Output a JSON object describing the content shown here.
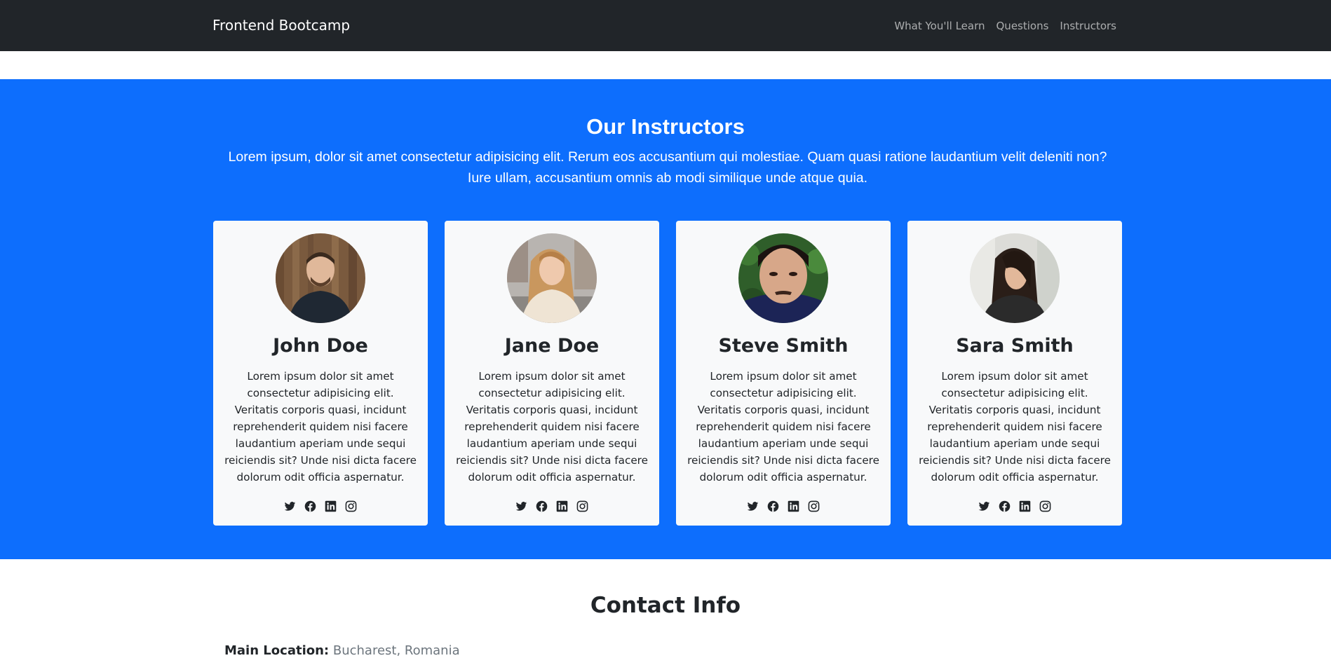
{
  "navbar": {
    "brand": "Frontend Bootcamp",
    "links": [
      "What You'll Learn",
      "Questions",
      "Instructors"
    ]
  },
  "instructors": {
    "title": "Our Instructors",
    "lead": "Lorem ipsum, dolor sit amet consectetur adipisicing elit. Rerum eos accusantium qui molestiae. Quam quasi ratione laudantium velit deleniti non? Iure ullam, accusantium omnis ab modi similique unde atque quia.",
    "cards": [
      {
        "name": "John Doe",
        "bio": "Lorem ipsum dolor sit amet consectetur adipisicing elit. Veritatis corporis quasi, incidunt reprehenderit quidem nisi facere laudantium aperiam unde sequi reiciendis sit? Unde nisi dicta facere dolorum odit officia aspernatur."
      },
      {
        "name": "Jane Doe",
        "bio": "Lorem ipsum dolor sit amet consectetur adipisicing elit. Veritatis corporis quasi, incidunt reprehenderit quidem nisi facere laudantium aperiam unde sequi reiciendis sit? Unde nisi dicta facere dolorum odit officia aspernatur."
      },
      {
        "name": "Steve Smith",
        "bio": "Lorem ipsum dolor sit amet consectetur adipisicing elit. Veritatis corporis quasi, incidunt reprehenderit quidem nisi facere laudantium aperiam unde sequi reiciendis sit? Unde nisi dicta facere dolorum odit officia aspernatur."
      },
      {
        "name": "Sara Smith",
        "bio": "Lorem ipsum dolor sit amet consectetur adipisicing elit. Veritatis corporis quasi, incidunt reprehenderit quidem nisi facere laudantium aperiam unde sequi reiciendis sit? Unde nisi dicta facere dolorum odit officia aspernatur."
      }
    ],
    "social_icons": [
      "twitter-icon",
      "facebook-icon",
      "linkedin-icon",
      "instagram-icon"
    ]
  },
  "contact": {
    "title": "Contact Info",
    "location_label": "Main Location:",
    "location_value": "Bucharest, Romania"
  },
  "colors": {
    "navbar_bg": "#212529",
    "primary": "#0d6efd",
    "card_bg": "#f8f9fa",
    "text": "#212529"
  }
}
